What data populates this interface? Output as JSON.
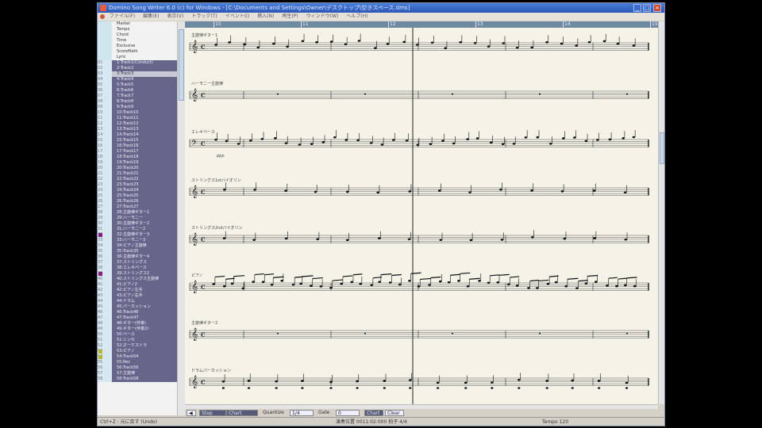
{
  "window": {
    "title": "Domino Song Writer 6.0 (c) for Windows - [C:\\Documents and Settings\\Owner\\デスクトップ\\空きスペース.dms]"
  },
  "menu": [
    "ファイル(F)",
    "編集(E)",
    "表示(V)",
    "トラック(T)",
    "イベント(I)",
    "挿入(N)",
    "再生(P)",
    "ウィンドウ(W)",
    "ヘルプ(H)"
  ],
  "tracks": [
    {
      "num": "",
      "name": "Marker",
      "kind": "master"
    },
    {
      "num": "",
      "name": "Tempo",
      "kind": "master"
    },
    {
      "num": "",
      "name": "Chord",
      "kind": "master"
    },
    {
      "num": "",
      "name": "Time",
      "kind": "master"
    },
    {
      "num": "",
      "name": "Exclusive",
      "kind": "master"
    },
    {
      "num": "",
      "name": "ScoreMath",
      "kind": "master"
    },
    {
      "num": "",
      "name": "Lyric",
      "kind": "master"
    },
    {
      "num": "01",
      "name": "1:Track1(Conduct)",
      "kind": "hl"
    },
    {
      "num": "02",
      "name": "2:Track2",
      "kind": "hl"
    },
    {
      "num": "03",
      "name": "3:Track3",
      "kind": "sel"
    },
    {
      "num": "04",
      "name": "4:Track4",
      "kind": "hl"
    },
    {
      "num": "05",
      "name": "5:Track5",
      "kind": "hl"
    },
    {
      "num": "06",
      "name": "6:Track6",
      "kind": "hl"
    },
    {
      "num": "07",
      "name": "7:Track7",
      "kind": "hl"
    },
    {
      "num": "08",
      "name": "8:Track8",
      "kind": "hl"
    },
    {
      "num": "09",
      "name": "9:Track9",
      "kind": "hl"
    },
    {
      "num": "10",
      "name": "10:Track10",
      "kind": "hl"
    },
    {
      "num": "11",
      "name": "11:Track11",
      "kind": "hl"
    },
    {
      "num": "12",
      "name": "12:Track12",
      "kind": "hl"
    },
    {
      "num": "13",
      "name": "13:Track13",
      "kind": "hl"
    },
    {
      "num": "14",
      "name": "14:Track14",
      "kind": "hl"
    },
    {
      "num": "15",
      "name": "15:Track15",
      "kind": "hl"
    },
    {
      "num": "16",
      "name": "16:Track16",
      "kind": "hl"
    },
    {
      "num": "17",
      "name": "17:Track17",
      "kind": "hl"
    },
    {
      "num": "18",
      "name": "18:Track18",
      "kind": "hl"
    },
    {
      "num": "19",
      "name": "19:Track19",
      "kind": "hl"
    },
    {
      "num": "20",
      "name": "20:Track20",
      "kind": "hl"
    },
    {
      "num": "21",
      "name": "21:Track21",
      "kind": "hl"
    },
    {
      "num": "22",
      "name": "22:Track22",
      "kind": "hl"
    },
    {
      "num": "23",
      "name": "23:Track23",
      "kind": "hl"
    },
    {
      "num": "24",
      "name": "24:Track24",
      "kind": "hl"
    },
    {
      "num": "25",
      "name": "25:Track25",
      "kind": "hl"
    },
    {
      "num": "26",
      "name": "26:Track26",
      "kind": "hl"
    },
    {
      "num": "27",
      "name": "27:Track27",
      "kind": "hl"
    },
    {
      "num": "28",
      "name": "28:主旋律ギター1",
      "kind": "hl"
    },
    {
      "num": "29",
      "name": "29:ハーモニー",
      "kind": "hl"
    },
    {
      "num": "30",
      "name": "30:主旋律ギター2",
      "kind": "hl"
    },
    {
      "num": "31",
      "name": "31:ハーモニー2",
      "kind": "hl"
    },
    {
      "num": "32",
      "name": "32:主旋律ギター3",
      "kind": "hl",
      "dot": "#8a1a8a"
    },
    {
      "num": "33",
      "name": "33:ハーモニー3",
      "kind": "hl"
    },
    {
      "num": "34",
      "name": "34:ピアノ主旋律",
      "kind": "hl"
    },
    {
      "num": "35",
      "name": "35:Track35",
      "kind": "hl"
    },
    {
      "num": "36",
      "name": "36:主旋律ギター4",
      "kind": "hl"
    },
    {
      "num": "37",
      "name": "37:ストリングス",
      "kind": "hl"
    },
    {
      "num": "38",
      "name": "38:エレキベース",
      "kind": "hl"
    },
    {
      "num": "39",
      "name": "39:ストリングス2",
      "kind": "hl",
      "dot": "#8a1a8a"
    },
    {
      "num": "40",
      "name": "40:ストリングス主旋律",
      "kind": "hl"
    },
    {
      "num": "41",
      "name": "41:ピアノ2",
      "kind": "hl"
    },
    {
      "num": "42",
      "name": "42:ピアノ左手",
      "kind": "hl"
    },
    {
      "num": "43",
      "name": "43:ピアノ右手",
      "kind": "hl"
    },
    {
      "num": "44",
      "name": "44:ドラム",
      "kind": "hl"
    },
    {
      "num": "45",
      "name": "45:パーカッション",
      "kind": "hl"
    },
    {
      "num": "46",
      "name": "46:Track46",
      "kind": "hl"
    },
    {
      "num": "47",
      "name": "47:Track47",
      "kind": "hl"
    },
    {
      "num": "48",
      "name": "48:ギター(伴奏)",
      "kind": "hl"
    },
    {
      "num": "49",
      "name": "49:ギター(伴奏2)",
      "kind": "hl"
    },
    {
      "num": "50",
      "name": "50:ベース",
      "kind": "hl"
    },
    {
      "num": "51",
      "name": "51:シンセ",
      "kind": "hl"
    },
    {
      "num": "52",
      "name": "52:オーケストラ",
      "kind": "hl"
    },
    {
      "num": "53",
      "name": "53:ピアノ",
      "kind": "hl",
      "dot": "#b8b82a"
    },
    {
      "num": "54",
      "name": "54:Track54",
      "kind": "hl",
      "dot": "#b8b82a"
    },
    {
      "num": "55",
      "name": "55:Rec",
      "kind": "hl"
    },
    {
      "num": "56",
      "name": "56:Track56",
      "kind": "hl"
    },
    {
      "num": "57",
      "name": "57:主旋律",
      "kind": "hl"
    },
    {
      "num": "58",
      "name": "58:Track58",
      "kind": "hl"
    }
  ],
  "ruler_labels": [
    "10",
    "11",
    "12",
    "13",
    "14",
    "15"
  ],
  "staves": [
    {
      "name": "主旋律ギター1",
      "clef": "treble",
      "style": "melody"
    },
    {
      "name": "ハーモニー主旋律",
      "clef": "treble",
      "style": "rest"
    },
    {
      "name": "エレキベース",
      "clef": "bass",
      "style": "bass"
    },
    {
      "name": "ストリングス1stバイオリン",
      "clef": "treble",
      "style": "sparse"
    },
    {
      "name": "ストリングス2ndバイオリン",
      "clef": "treble",
      "style": "sparse"
    },
    {
      "name": "ピアノ",
      "clef": "treble",
      "style": "dense"
    },
    {
      "name": "主旋律ギター2",
      "clef": "treble",
      "style": "rest"
    },
    {
      "name": "ドラムパーカッション",
      "clef": "treble",
      "style": "drum"
    }
  ],
  "staff_extra_label": "ppp",
  "toolbar": {
    "left_arrow": "◀",
    "view_mode": "Step",
    "view_sub": "Chart",
    "quantize_label": "Quantize",
    "quantize_value": "1/4",
    "gate_label": "Gate",
    "gate_value": "0",
    "btn_chart": "Chart",
    "btn_clear": "Clear"
  },
  "status": {
    "left": "Ctrl+Z : 元に戻す (Undo)",
    "mid": "演奏位置 0011:02:000  拍子 4/4",
    "right": "Tempo 120"
  }
}
